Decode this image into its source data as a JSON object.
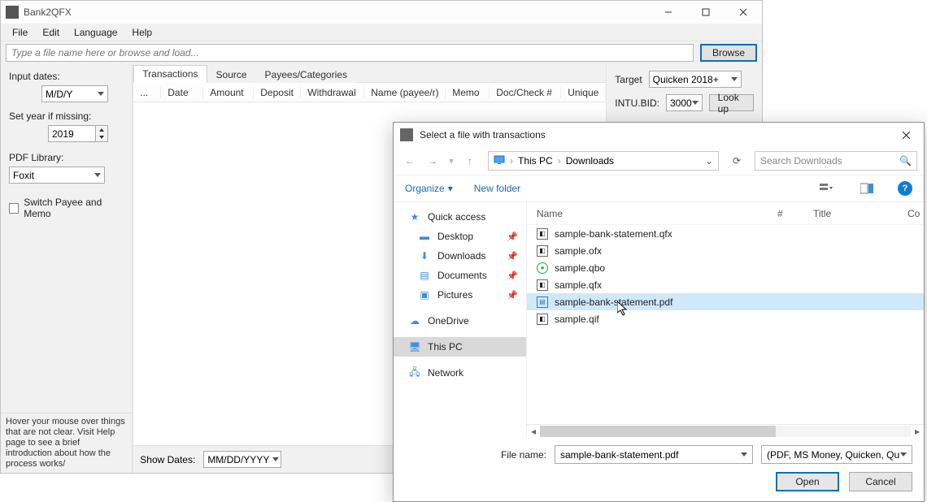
{
  "app": {
    "title": "Bank2QFX",
    "menus": [
      "File",
      "Edit",
      "Language",
      "Help"
    ],
    "path_placeholder": "Type a file name here or browse and load...",
    "browse": "Browse"
  },
  "left": {
    "input_dates_label": "Input dates:",
    "input_dates_value": "M/D/Y",
    "set_year_label": "Set year if missing:",
    "set_year_value": "2019",
    "pdf_library_label": "PDF Library:",
    "pdf_library_value": "Foxit",
    "switch_label": "Switch Payee and Memo",
    "hint": "Hover your mouse over things that are not clear. Visit Help page to see a brief introduction about how the process works/"
  },
  "tabs": [
    "Transactions",
    "Source",
    "Payees/Categories"
  ],
  "columns": [
    "...",
    "Date",
    "Amount",
    "Deposit",
    "Withdrawal",
    "Name (payee/r)",
    "Memo",
    "Doc/Check #",
    "Unique"
  ],
  "showdates_label": "Show Dates:",
  "showdates_value": "MM/DD/YYYY",
  "right": {
    "target_label": "Target",
    "target_value": "Quicken 2018+",
    "intubid_label": "INTU.BID:",
    "intubid_value": "3000",
    "lookup": "Look up"
  },
  "dialog": {
    "title": "Select a file with transactions",
    "crumb_root": "This PC",
    "crumb_folder": "Downloads",
    "search_placeholder": "Search Downloads",
    "organize": "Organize",
    "new_folder": "New folder",
    "tree": {
      "quick": "Quick access",
      "desktop": "Desktop",
      "downloads": "Downloads",
      "documents": "Documents",
      "pictures": "Pictures",
      "onedrive": "OneDrive",
      "thispc": "This PC",
      "network": "Network"
    },
    "list_head": {
      "name": "Name",
      "num": "#",
      "title": "Title",
      "co": "Co"
    },
    "files": [
      {
        "name": "sample-bank-statement.qfx",
        "type": "qfx"
      },
      {
        "name": "sample.ofx",
        "type": "ofx"
      },
      {
        "name": "sample.qbo",
        "type": "qbo"
      },
      {
        "name": "sample.qfx",
        "type": "qfx"
      },
      {
        "name": "sample-bank-statement.pdf",
        "type": "pdf",
        "selected": true
      },
      {
        "name": "sample.qif",
        "type": "qif"
      }
    ],
    "filename_label": "File name:",
    "filename_value": "sample-bank-statement.pdf",
    "filter_value": "(PDF, MS Money, Quicken, Qui",
    "open": "Open",
    "cancel": "Cancel"
  }
}
